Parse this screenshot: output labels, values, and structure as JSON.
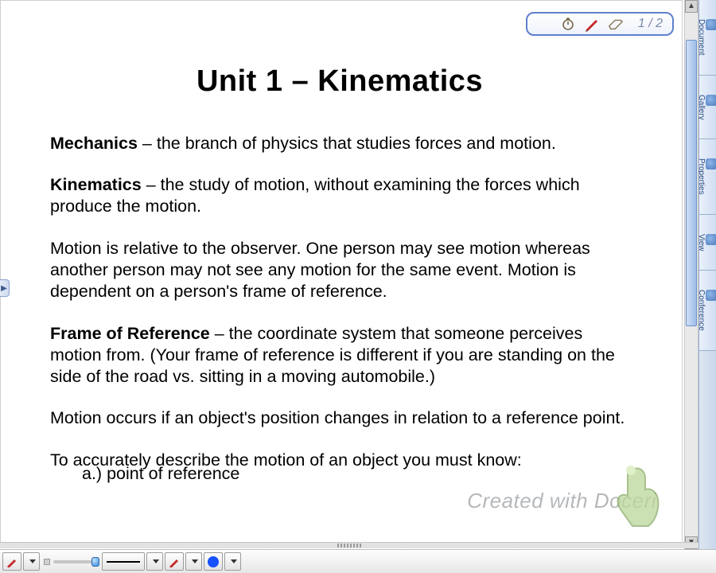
{
  "title": "Unit 1 – Kinematics",
  "page_indicator": {
    "label": "1 / 2"
  },
  "side_tabs": [
    {
      "name": "document",
      "label": "Document"
    },
    {
      "name": "gallery",
      "label": "Gallery"
    },
    {
      "name": "properties",
      "label": "Properties"
    },
    {
      "name": "view",
      "label": "View"
    },
    {
      "name": "conference",
      "label": "Conference"
    }
  ],
  "definitions": {
    "mechanics": {
      "term": "Mechanics",
      "dash": " – ",
      "body": "the branch of physics that studies forces and motion."
    },
    "kinematics": {
      "term": "Kinematics",
      "dash": " – ",
      "body": "the study of motion, without examining the forces which produce the motion."
    },
    "frame_of_reference": {
      "term": "Frame of Reference",
      "dash": " – ",
      "body": "the coordinate system that someone perceives motion from.  (Your frame of reference is different if you are standing on the side of the road vs. sitting in a moving automobile.)"
    }
  },
  "paragraphs": {
    "relativity": "Motion is relative to the observer.  One person may see motion whereas another person may not see any motion for the same event.  Motion is dependent on a person's frame of reference.",
    "motion_occurs": "Motion occurs if an object's position changes in relation to a reference point.",
    "describe_intro": "To accurately describe the motion of an object you must know:",
    "list_a": "a.)  point of reference"
  },
  "watermark": "Created with Doceri",
  "toolbar": {
    "pen_label": "pen",
    "line_style": "solid-thin",
    "color": "#1650ff"
  }
}
